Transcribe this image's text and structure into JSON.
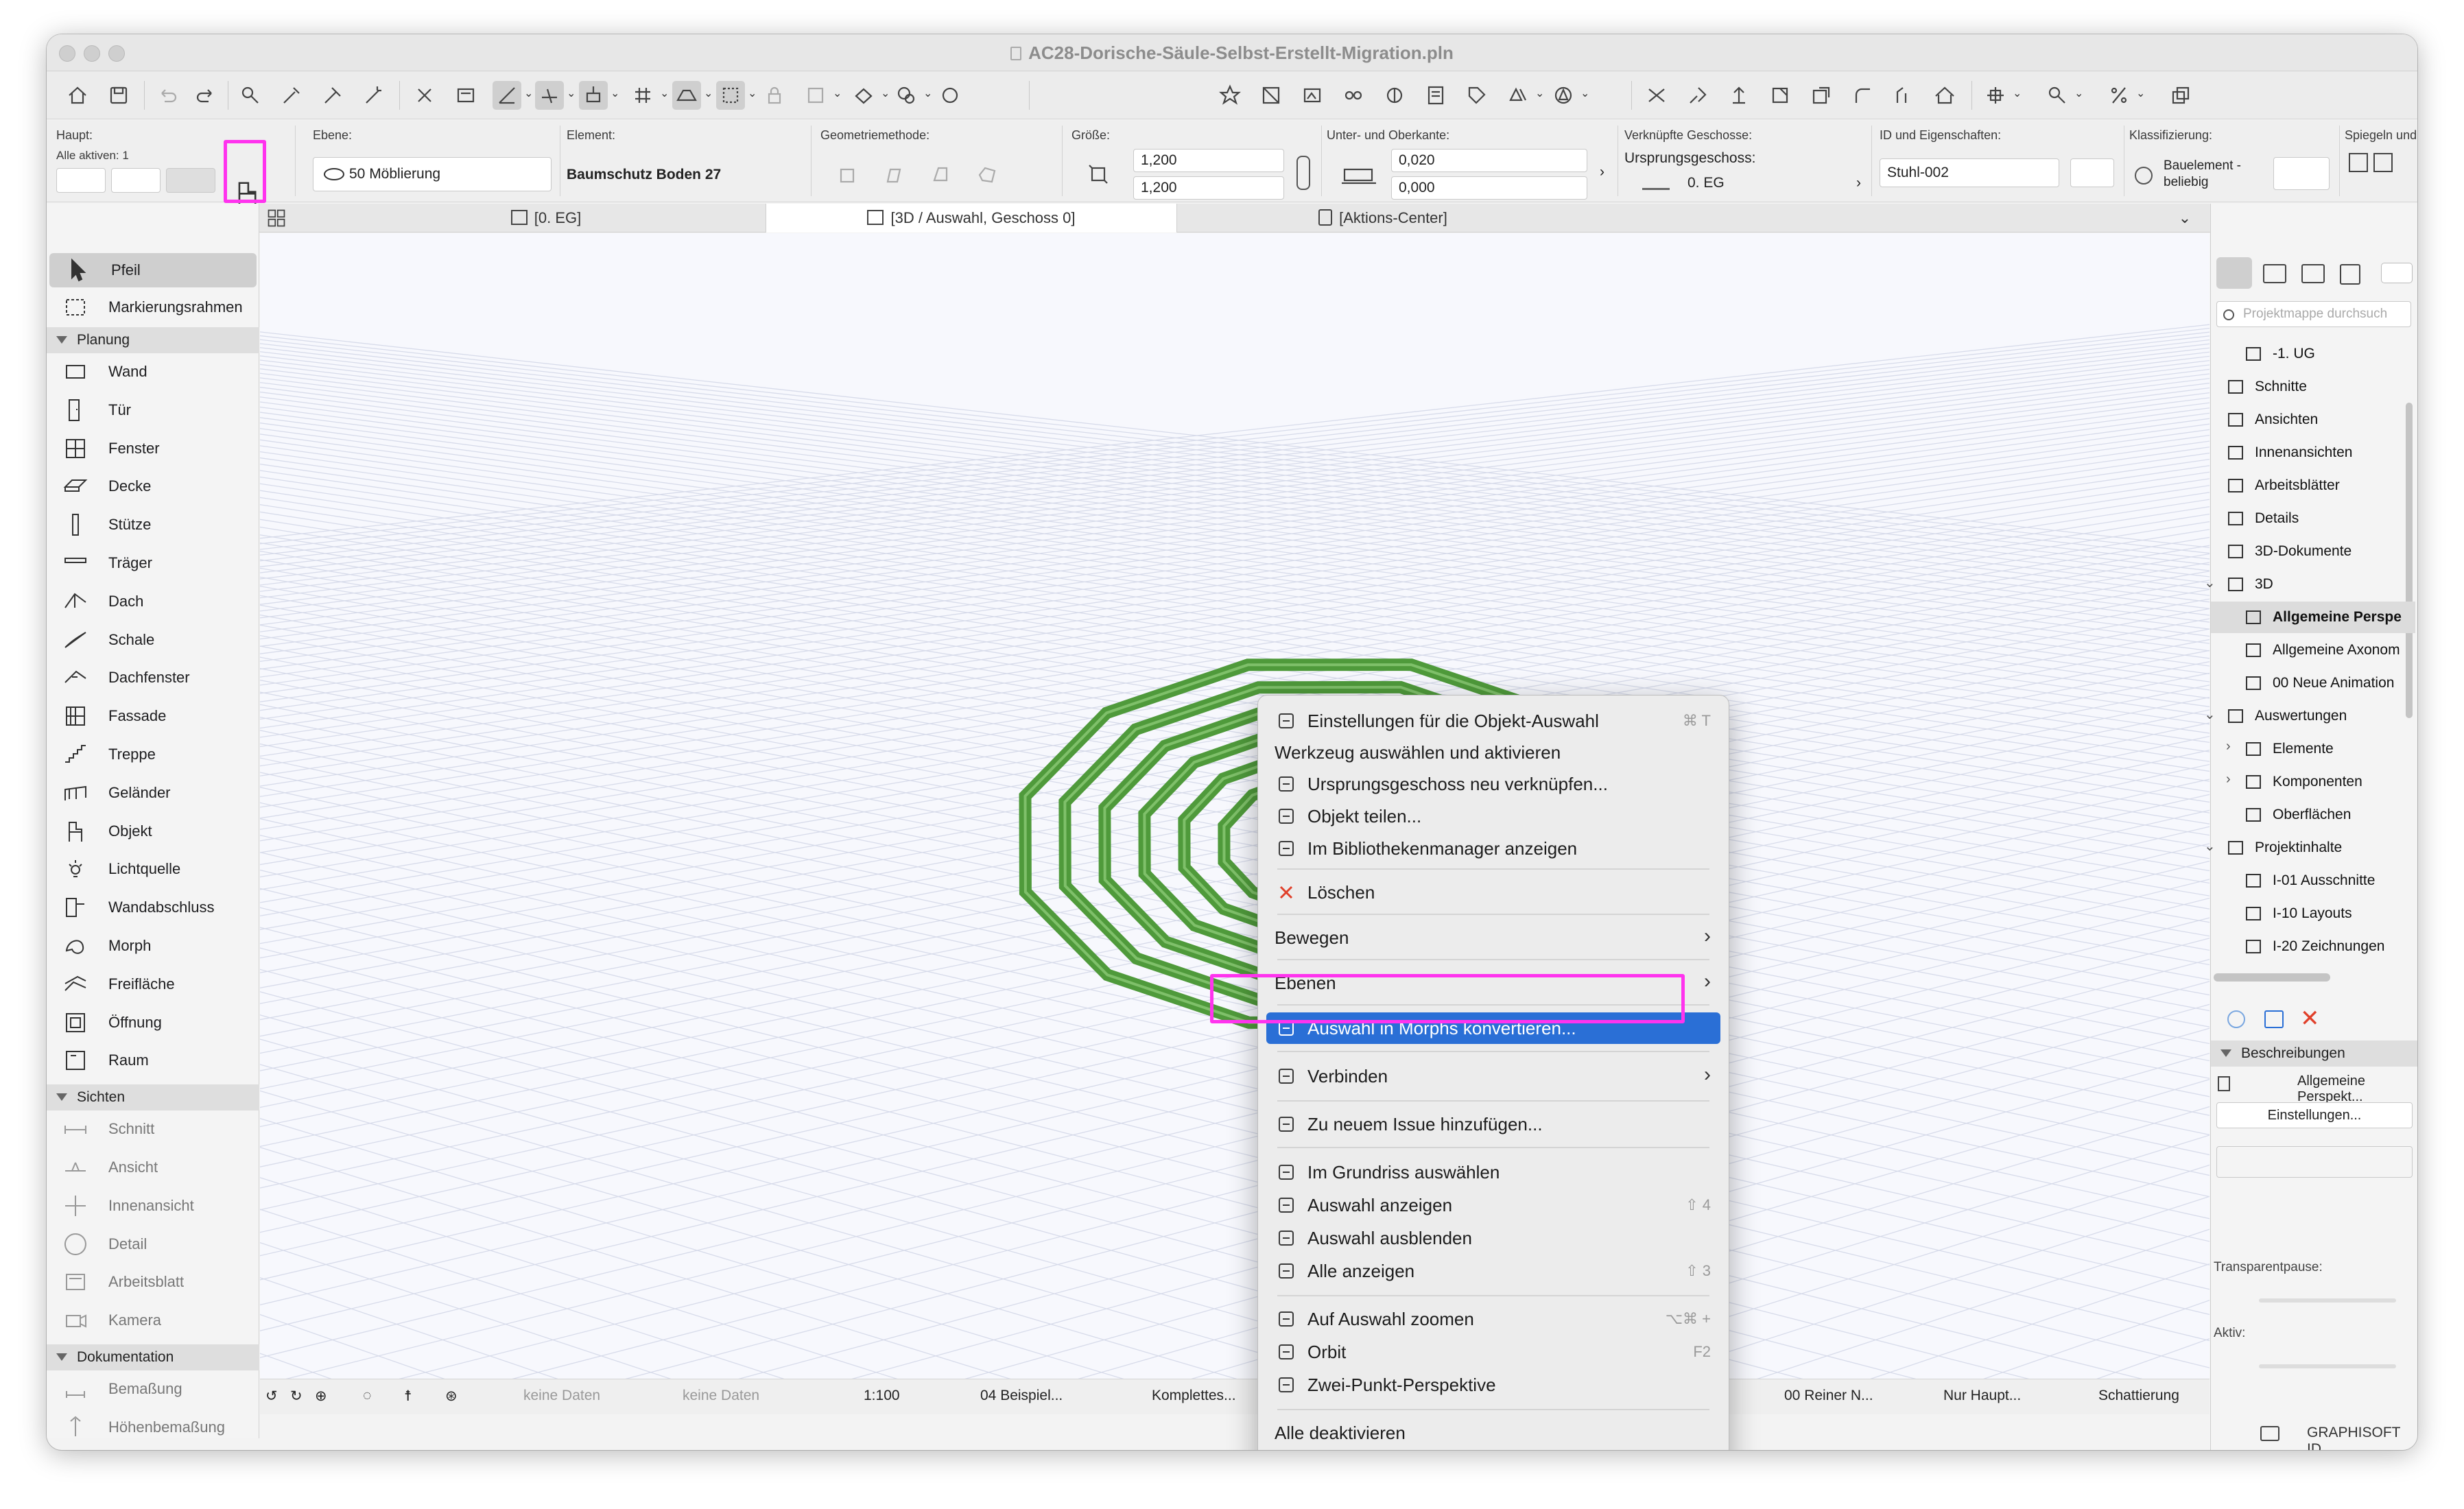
{
  "window": {
    "title": "AC28-Dorische-Säule-Selbst-Erstellt-Migration.pln"
  },
  "infobox": {
    "haupt_label": "Haupt:",
    "alle_aktiven": "Alle aktiven: 1",
    "ebene_label": "Ebene:",
    "ebene_value": "50 Möblierung",
    "element_label": "Element:",
    "element_value": "Baumschutz Boden 27",
    "geometrie_label": "Geometriemethode:",
    "groesse_label": "Größe:",
    "groesse_a": "1,200",
    "groesse_b": "1,200",
    "kante_label": "Unter- und Oberkante:",
    "kante_a": "0,020",
    "kante_b": "0,000",
    "geschosse_label": "Verknüpfte Geschosse:",
    "ursprung_label": "Ursprungsgeschoss:",
    "ursprung_value": "0. EG",
    "id_label": "ID und Eigenschaften:",
    "id_value": "Stuhl-002",
    "klass_label": "Klassifizierung:",
    "klass_value_1": "Bauelement -",
    "klass_value_2": "beliebig",
    "spiegeln_label": "Spiegeln und"
  },
  "tabs": [
    "[0. EG]",
    "[3D / Auswahl, Geschoss 0]",
    "[Aktions-Center]"
  ],
  "toolbox": {
    "arrow": "Pfeil",
    "marquee": "Markierungsrahmen",
    "groups": [
      "Planung",
      "Sichten",
      "Dokumentation"
    ],
    "planung": [
      "Wand",
      "Tür",
      "Fenster",
      "Decke",
      "Stütze",
      "Träger",
      "Dach",
      "Schale",
      "Dachfenster",
      "Fassade",
      "Treppe",
      "Geländer",
      "Objekt",
      "Lichtquelle",
      "Wandabschluss",
      "Morph",
      "Freifläche",
      "Öffnung",
      "Raum"
    ],
    "sichten": [
      "Schnitt",
      "Ansicht",
      "Innenansicht",
      "Detail",
      "Arbeitsblatt",
      "Kamera"
    ],
    "dokumentation": [
      "Bemaßung",
      "Höhenbemaßung"
    ]
  },
  "navigator": {
    "search_placeholder": "Projektmappe durchsuch",
    "items": [
      "-1. UG",
      "Schnitte",
      "Ansichten",
      "Innenansichten",
      "Arbeitsblätter",
      "Details",
      "3D-Dokumente",
      "3D",
      "Allgemeine Perspe",
      "Allgemeine Axonom",
      "00 Neue Animation",
      "Auswertungen",
      "Elemente",
      "Komponenten",
      "Oberflächen",
      "Projektinhalte",
      "I-01 Ausschnitte",
      "I-10 Layouts",
      "I-20 Zeichnungen"
    ],
    "beschreibungen": "Beschreibungen",
    "beschreibung_item": "Allgemeine Perspekt...",
    "einstellungen": "Einstellungen...",
    "transparent": "Transparentpause:",
    "aktiv": "Aktiv:",
    "brand": "GRAPHISOFT ID"
  },
  "status": {
    "keine1": "keine Daten",
    "keine2": "keine Daten",
    "scale": "1:100",
    "beispiel": "04 Beispiel...",
    "komplett": "Komplettes...",
    "reiner": "00 Reiner N...",
    "nurhaupt": "Nur Haupt...",
    "schattierung": "Schattierung"
  },
  "context_menu": {
    "items": [
      {
        "label": "Einstellungen für die Objekt-Auswahl",
        "shortcut": "⌘ T",
        "icon": "object-settings-icon"
      },
      {
        "label": "Werkzeug auswählen und aktivieren",
        "shortcut": "",
        "icon": ""
      },
      {
        "label": "Ursprungsgeschoss neu verknüpfen...",
        "shortcut": "",
        "icon": "story-link-icon"
      },
      {
        "label": "Objekt teilen...",
        "shortcut": "",
        "icon": "share-object-icon"
      },
      {
        "label": "Im Bibliothekenmanager anzeigen",
        "shortcut": "",
        "icon": "library-icon"
      },
      {
        "label": "Löschen",
        "shortcut": "",
        "icon": "delete-icon"
      },
      {
        "label": "Bewegen",
        "shortcut": "",
        "icon": ""
      },
      {
        "label": "Ebenen",
        "shortcut": "",
        "icon": ""
      },
      {
        "label": "Auswahl in Morphs konvertieren...",
        "shortcut": "",
        "icon": "convert-morph-icon"
      },
      {
        "label": "Verbinden",
        "shortcut": "",
        "icon": "connect-icon"
      },
      {
        "label": "Zu neuem Issue hinzufügen...",
        "shortcut": "",
        "icon": "issue-icon"
      },
      {
        "label": "Im Grundriss auswählen",
        "shortcut": "",
        "icon": "floorplan-select-icon"
      },
      {
        "label": "Auswahl anzeigen",
        "shortcut": "⇧ 4",
        "icon": "show-selection-icon"
      },
      {
        "label": "Auswahl ausblenden",
        "shortcut": "",
        "icon": "hide-selection-icon"
      },
      {
        "label": "Alle anzeigen",
        "shortcut": "⇧ 3",
        "icon": "show-all-icon"
      },
      {
        "label": "Auf Auswahl zoomen",
        "shortcut": "⌥⌘ +",
        "icon": "zoom-selection-icon"
      },
      {
        "label": "Orbit",
        "shortcut": "F2",
        "icon": "orbit-icon"
      },
      {
        "label": "Zwei-Punkt-Perspektive",
        "shortcut": "",
        "icon": "two-point-icon"
      },
      {
        "label": "Alle deaktivieren",
        "shortcut": "",
        "icon": ""
      }
    ]
  },
  "colors": {
    "accent": "#2a6fd6",
    "highlight": "#ff33ee",
    "model": "#4f9a3b",
    "grid": "#d7dbea"
  }
}
